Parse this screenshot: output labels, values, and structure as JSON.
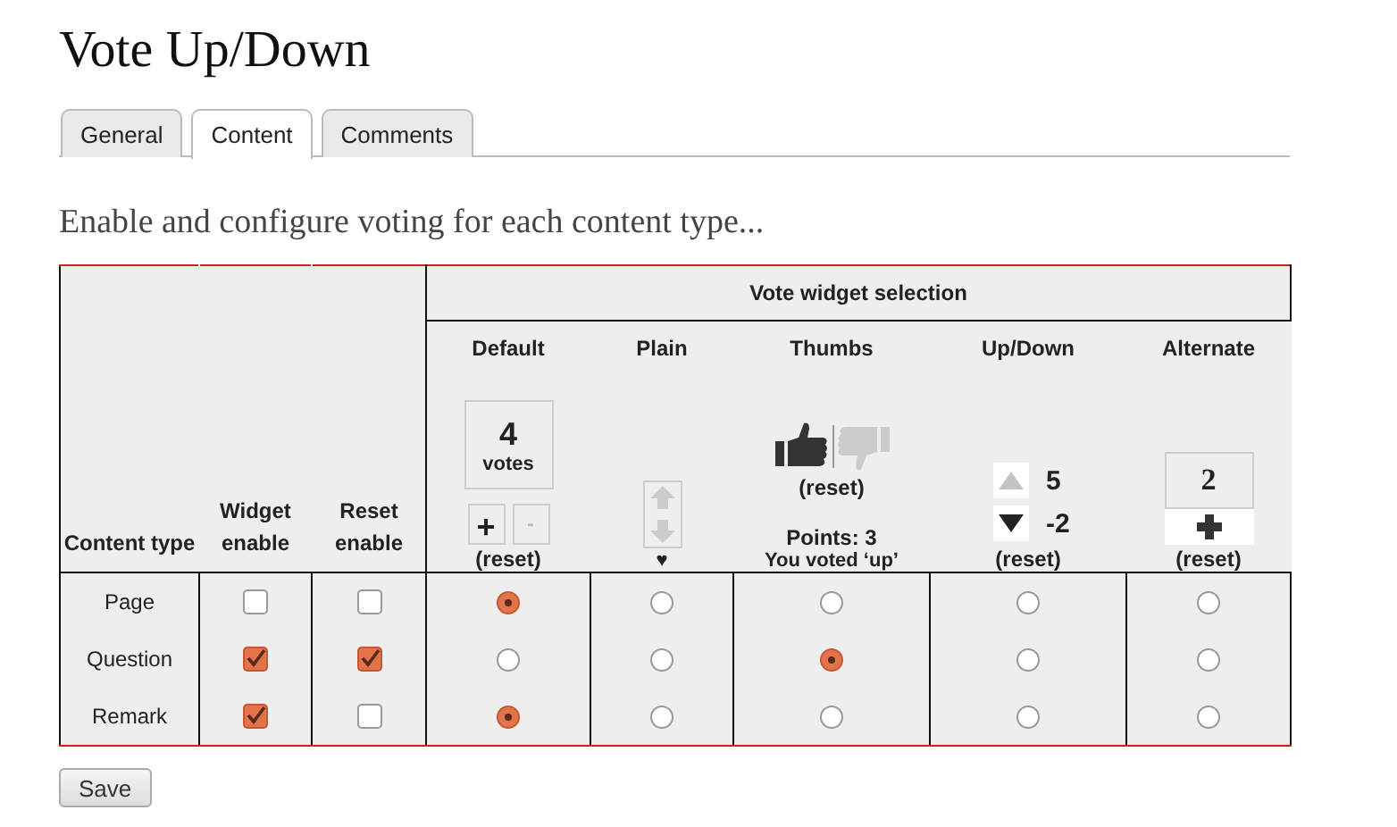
{
  "page_title": "Vote Up/Down",
  "tabs": [
    {
      "label": "General",
      "selected": false
    },
    {
      "label": "Content",
      "selected": true
    },
    {
      "label": "Comments",
      "selected": false
    }
  ],
  "intro": "Enable and configure voting for each content type...",
  "table": {
    "group_heading": "Vote widget selection",
    "columns": [
      {
        "label": "Content type"
      },
      {
        "label": "Widget enable"
      },
      {
        "label": "Reset enable"
      }
    ],
    "widgets": [
      {
        "kind": "default",
        "label": "Default",
        "count": "4",
        "unit": "votes",
        "plus": "+",
        "minus": "-",
        "reset": "(reset)"
      },
      {
        "kind": "plain",
        "label": "Plain",
        "mark": "♥"
      },
      {
        "kind": "thumbs",
        "label": "Thumbs",
        "reset": "(reset)",
        "points": "Points: 3",
        "note": "You voted ‘up’"
      },
      {
        "kind": "updown",
        "label": "Up/Down",
        "up_count": "5",
        "down_count": "-2",
        "reset": "(reset)"
      },
      {
        "kind": "alternate",
        "label": "Alternate",
        "count": "2",
        "reset": "(reset)"
      }
    ],
    "rows": [
      {
        "type": "Page",
        "widget_enable": false,
        "reset_enable": false,
        "choices": [
          {
            "selected": true
          },
          {
            "selected": false
          },
          {
            "selected": false
          },
          {
            "selected": false
          },
          {
            "selected": false
          }
        ]
      },
      {
        "type": "Question",
        "widget_enable": true,
        "reset_enable": true,
        "choices": [
          {
            "selected": false
          },
          {
            "selected": false
          },
          {
            "selected": true
          },
          {
            "selected": false
          },
          {
            "selected": false
          }
        ]
      },
      {
        "type": "Remark",
        "widget_enable": true,
        "reset_enable": false,
        "choices": [
          {
            "selected": true
          },
          {
            "selected": false
          },
          {
            "selected": false
          },
          {
            "selected": false
          },
          {
            "selected": false
          }
        ]
      }
    ]
  },
  "save": "Save"
}
